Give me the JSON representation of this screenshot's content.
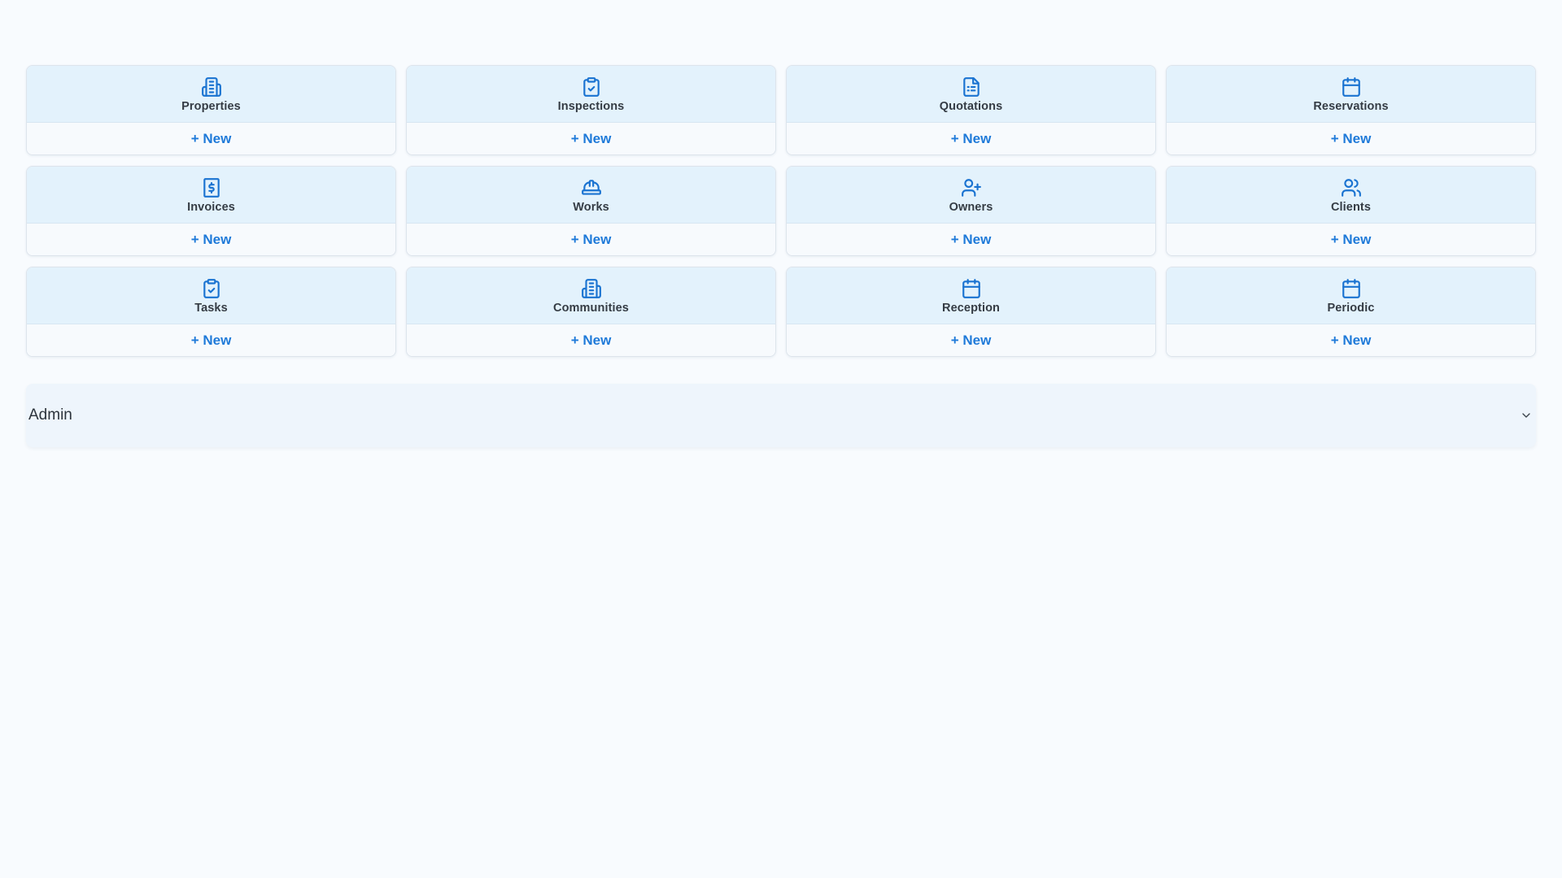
{
  "colors": {
    "accent": "#1f7ad9",
    "card_header_bg": "#e3f2fc",
    "page_bg": "#f8fbfe",
    "admin_bg": "#eef5fc"
  },
  "cards": [
    {
      "title": "Properties",
      "icon": "building-icon",
      "new_label": "+ New"
    },
    {
      "title": "Inspections",
      "icon": "clipboard-check-icon",
      "new_label": "+ New"
    },
    {
      "title": "Quotations",
      "icon": "file-text-icon",
      "new_label": "+ New"
    },
    {
      "title": "Reservations",
      "icon": "calendar-icon",
      "new_label": "+ New"
    },
    {
      "title": "Invoices",
      "icon": "receipt-dollar-icon",
      "new_label": "+ New"
    },
    {
      "title": "Works",
      "icon": "hard-hat-icon",
      "new_label": "+ New"
    },
    {
      "title": "Owners",
      "icon": "user-plus-icon",
      "new_label": "+ New"
    },
    {
      "title": "Clients",
      "icon": "users-icon",
      "new_label": "+ New"
    },
    {
      "title": "Tasks",
      "icon": "clipboard-check-icon",
      "new_label": "+ New"
    },
    {
      "title": "Communities",
      "icon": "building-icon",
      "new_label": "+ New"
    },
    {
      "title": "Reception",
      "icon": "calendar-icon",
      "new_label": "+ New"
    },
    {
      "title": "Periodic",
      "icon": "calendar-icon",
      "new_label": "+ New"
    }
  ],
  "admin": {
    "label": "Admin",
    "icon": "chevron-down-icon"
  }
}
